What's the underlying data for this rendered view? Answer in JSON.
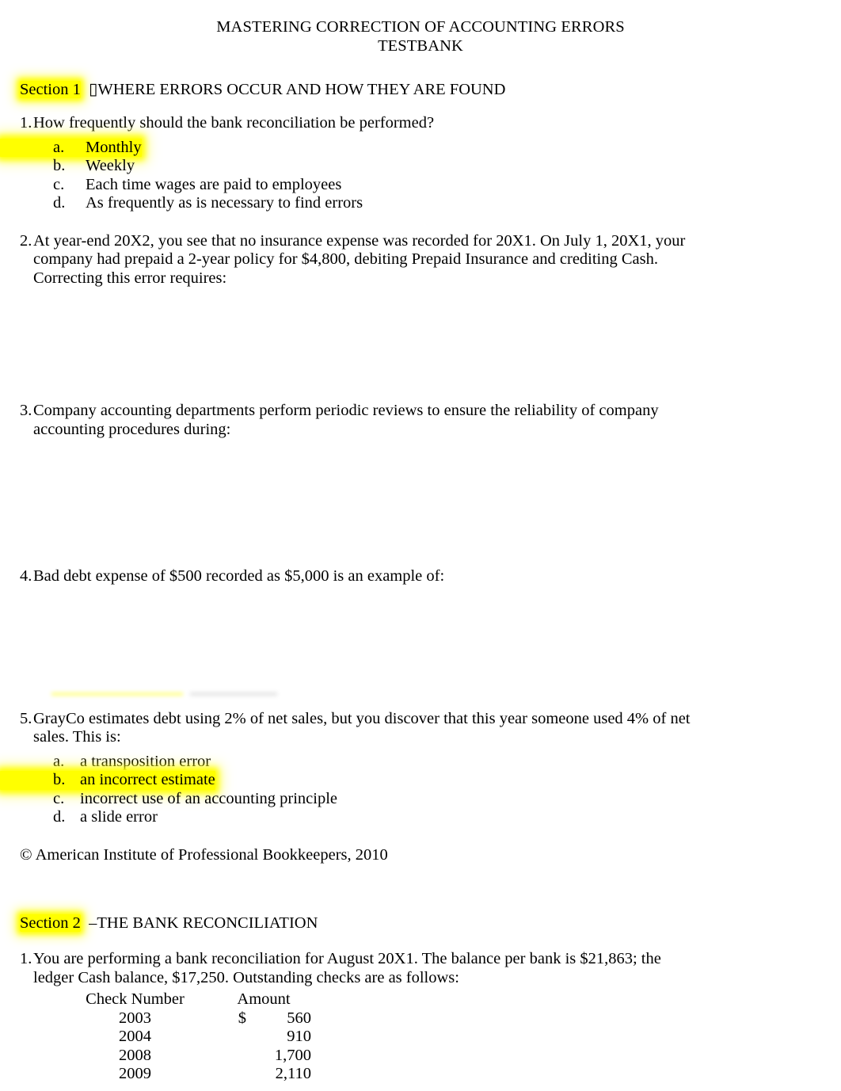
{
  "document": {
    "title_line_1": "MASTERING CORRECTION OF ACCOUNTING ERRORS",
    "title_line_2": "TESTBANK",
    "copyright": "© American Institute of Professional Bookkeepers, 2010"
  },
  "sections": [
    {
      "label": "Section 1",
      "separator": " ▯",
      "heading": "WHERE ERRORS OCCUR AND HOW THEY ARE FOUND",
      "label_highlighted": true,
      "questions": [
        {
          "number": "1.",
          "text": "How frequently should the bank reconciliation be performed?",
          "options": [
            {
              "letter": "a.",
              "text": "Monthly",
              "highlighted": true
            },
            {
              "letter": "b.",
              "text": "Weekly",
              "highlighted": false
            },
            {
              "letter": "c.",
              "text": "Each time wages are paid to employees",
              "highlighted": false
            },
            {
              "letter": "d.",
              "text": "As frequently as is necessary to find errors",
              "highlighted": false
            }
          ]
        },
        {
          "number": "2.",
          "text": "At year-end 20X2, you see that no insurance expense was recorded for 20X1. On July 1, 20X1, your company had prepaid a 2-year policy for $4,800, debiting Prepaid Insurance and crediting Cash. Correcting this error requires:",
          "options": []
        },
        {
          "number": "3.",
          "text": "Company accounting departments perform periodic reviews to ensure the reliability of company accounting procedures during:",
          "options": []
        },
        {
          "number": "4.",
          "text": "Bad debt expense of $500 recorded as $5,000 is an example of:",
          "options": []
        },
        {
          "number": "5.",
          "text": "GrayCo estimates debt using 2% of net sales, but you discover that this year someone used 4% of net sales. This is:",
          "options": [
            {
              "letter": "a.",
              "text": "a transposition error",
              "highlighted": false
            },
            {
              "letter": "b.",
              "text": "an incorrect estimate",
              "highlighted": true
            },
            {
              "letter": "c.",
              "text": "incorrect use of an accounting principle",
              "highlighted": false
            },
            {
              "letter": "d.",
              "text": "a slide error",
              "highlighted": false
            }
          ]
        }
      ]
    },
    {
      "label": "Section 2",
      "separator": " –",
      "heading": "THE BANK RECONCILIATION",
      "label_highlighted": true,
      "questions": [
        {
          "number": "1.",
          "text": "You are performing a bank reconciliation for August 20X1. The balance per bank is $21,863; the ledger Cash balance, $17,250. Outstanding checks are as follows:",
          "options": []
        }
      ]
    }
  ],
  "checks_table": {
    "headers": [
      "Check Number",
      "Amount"
    ],
    "rows": [
      {
        "check_number": "2003",
        "currency": "$",
        "amount": "560"
      },
      {
        "check_number": "2004",
        "currency": "",
        "amount": "910"
      },
      {
        "check_number": "2008",
        "currency": "",
        "amount": "1,700"
      },
      {
        "check_number": "2009",
        "currency": "",
        "amount": "2,110"
      }
    ]
  },
  "colors": {
    "highlight": "#ffff00",
    "text": "#000000",
    "page_background": "#ffffff"
  }
}
